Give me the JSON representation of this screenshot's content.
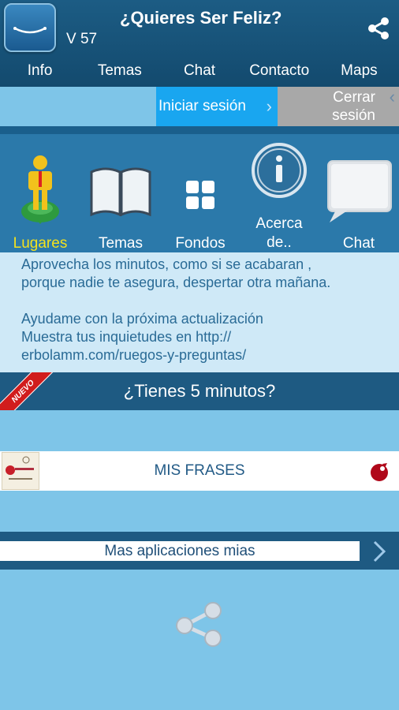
{
  "header": {
    "title": "¿Quieres Ser Feliz?",
    "version": "V 57",
    "share_icon": "share-icon"
  },
  "nav": {
    "items": [
      {
        "label": "Info"
      },
      {
        "label": "Temas"
      },
      {
        "label": "Chat"
      },
      {
        "label": "Contacto"
      },
      {
        "label": "Maps"
      }
    ]
  },
  "session": {
    "login_label": "Iniciar sesión",
    "logout_line1": "Cerrar",
    "logout_line2": "sesión"
  },
  "icons": {
    "items": [
      {
        "label": "Lugares",
        "icon": "map-pin-person-icon"
      },
      {
        "label": "Temas",
        "icon": "open-book-icon"
      },
      {
        "label": "Fondos",
        "icon": "grid-icon"
      },
      {
        "label_line1": "Acerca",
        "label_line2": "de..",
        "icon": "info-icon"
      },
      {
        "label": "Chat",
        "icon": "speech-bubble-icon"
      }
    ],
    "highlight_color": "#f4e21c"
  },
  "message": {
    "line1": "Aprovecha los minutos, como si se acabaran ,",
    "line2": "porque nadie te asegura, despertar otra mañana.",
    "line3": "Ayudame con la próxima actualización",
    "line4": "Muestra tus inquietudes en    http://",
    "line5": "erbolamm.com/ruegos-y-preguntas/"
  },
  "banner": {
    "badge": "NUEVO",
    "title": "¿Tienes 5 minutos?"
  },
  "frases": {
    "label": "MIS FRASES"
  },
  "apps": {
    "label": "Mas aplicaciones mias"
  },
  "colors": {
    "header": "#1c5c84",
    "background": "#7ec5e8",
    "login": "#19a6f0",
    "logout": "#a8a8a8",
    "panel": "#cfe9f7"
  }
}
